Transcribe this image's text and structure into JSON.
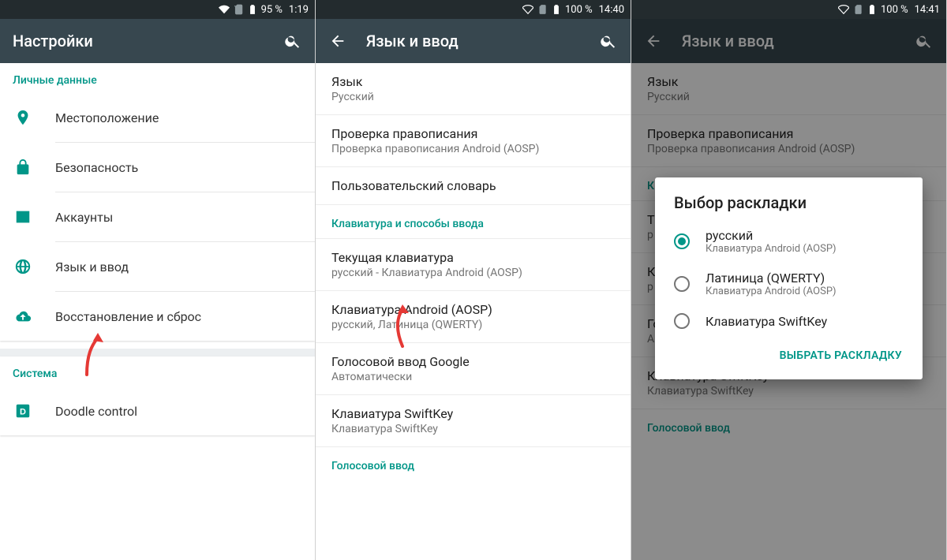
{
  "phone1": {
    "status": {
      "battery": "95 %",
      "time": "1:19"
    },
    "title": "Настройки",
    "section1": {
      "header": "Личные данные",
      "items": [
        {
          "label": "Местоположение"
        },
        {
          "label": "Безопасность"
        },
        {
          "label": "Аккаунты"
        },
        {
          "label": "Язык и ввод"
        },
        {
          "label": "Восстановление и сброс"
        }
      ]
    },
    "section2": {
      "header": "Система",
      "items": [
        {
          "label": "Doodle control"
        }
      ]
    }
  },
  "phone2": {
    "status": {
      "battery": "100 %",
      "time": "14:40"
    },
    "title": "Язык и ввод",
    "rows": [
      {
        "title": "Язык",
        "sub": "Русский"
      },
      {
        "title": "Проверка правописания",
        "sub": "Проверка правописания Android (AOSP)"
      },
      {
        "title": "Пользовательский словарь"
      }
    ],
    "kbHeader": "Клавиатура и способы ввода",
    "kbRows": [
      {
        "title": "Текущая клавиатура",
        "sub": "русский - Клавиатура Android (AOSP)"
      },
      {
        "title": "Клавиатура Android (AOSP)",
        "sub": "русский, Латиница (QWERTY)"
      },
      {
        "title": "Голосовой ввод Google",
        "sub": "Автоматически"
      },
      {
        "title": "Клавиатура SwiftKey",
        "sub": "Клавиатура SwiftKey"
      }
    ],
    "voiceHeader": "Голосовой ввод"
  },
  "phone3": {
    "status": {
      "battery": "100 %",
      "time": "14:41"
    },
    "title": "Язык и ввод",
    "rows": [
      {
        "title": "Язык",
        "sub": "Русский"
      },
      {
        "title": "Проверка правописания",
        "sub": "Проверка правописания Android (AOSP)"
      }
    ],
    "kbHeader": "К",
    "kbRows": [
      {
        "title": "Т",
        "sub": "р"
      },
      {
        "title": "К",
        "sub": "р"
      },
      {
        "title": "Голосовой ввод Google",
        "sub": "Автоматически"
      },
      {
        "title": "Клавиатура SwiftKey",
        "sub": "Клавиатура SwiftKey"
      }
    ],
    "voiceHeader": "Голосовой ввод",
    "dialog": {
      "title": "Выбор раскладки",
      "options": [
        {
          "title": "русский",
          "sub": "Клавиатура Android (AOSP)",
          "checked": true
        },
        {
          "title": "Латиница (QWERTY)",
          "sub": "Клавиатура Android (AOSP)",
          "checked": false
        },
        {
          "title": "Клавиатура SwiftKey",
          "checked": false
        }
      ],
      "action": "Выбрать раскладку"
    }
  }
}
